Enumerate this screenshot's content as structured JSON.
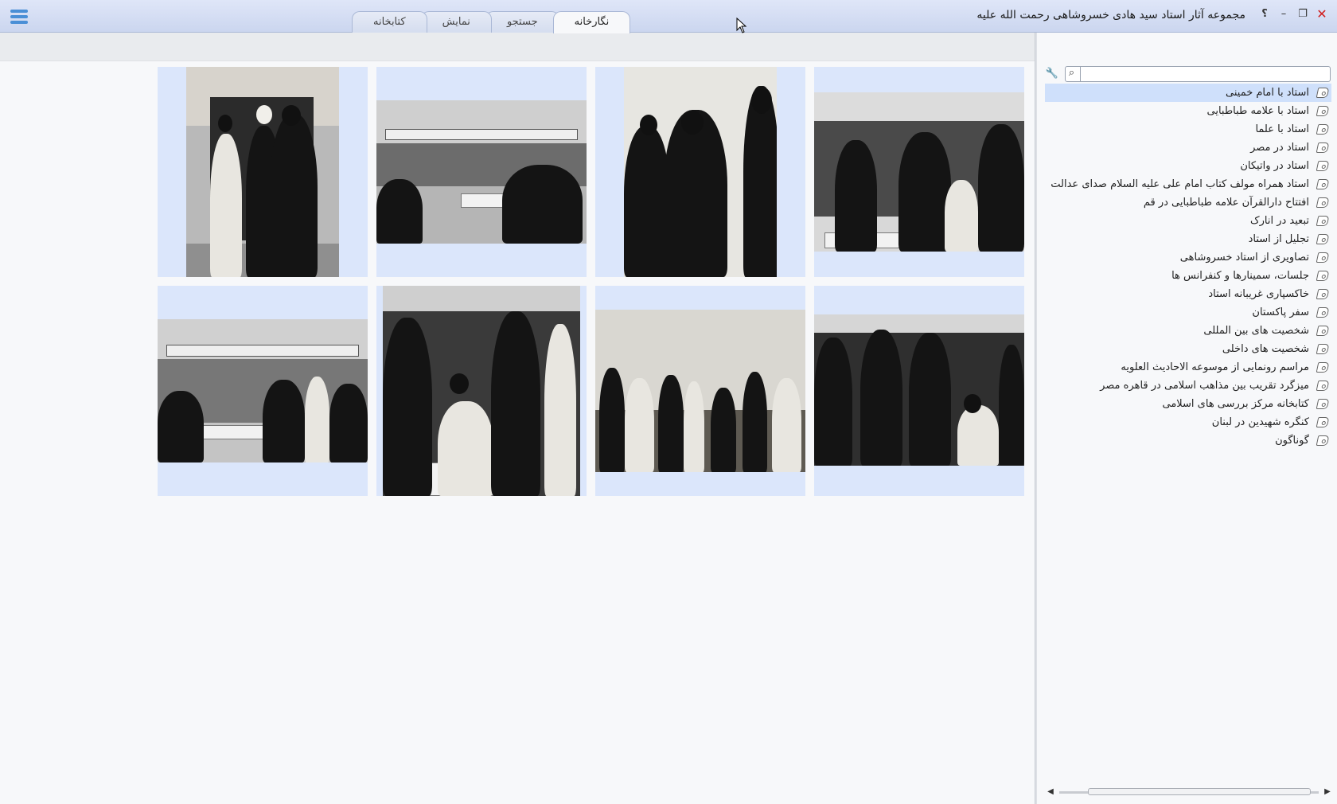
{
  "window": {
    "title": "مجموعه آثار استاد سید هادی خسروشاهی رحمت الله علیه",
    "help": "؟",
    "minimize": "–",
    "maximize": "❐",
    "close": "✕"
  },
  "tabs": [
    {
      "label": "نگارخانه",
      "active": true
    },
    {
      "label": "جستجو",
      "active": false
    },
    {
      "label": "نمایش",
      "active": false
    },
    {
      "label": "کتابخانه",
      "active": false
    }
  ],
  "sidebar": {
    "search": {
      "value": "",
      "placeholder": ""
    },
    "search_icon": "⌕",
    "wrench_icon": "🔧",
    "items": [
      {
        "label": "استاد با امام خمینی",
        "selected": true
      },
      {
        "label": "استاد با علامه طباطبایی"
      },
      {
        "label": "استاد با علما"
      },
      {
        "label": "استاد در مصر"
      },
      {
        "label": "استاد در واتیکان"
      },
      {
        "label": "استاد همراه مولف کتاب امام علی علیه السلام صدای عدالت"
      },
      {
        "label": "افتتاح دارالقرآن علامه طباطبایی در قم"
      },
      {
        "label": "تبعید در انارک"
      },
      {
        "label": "تجلیل از استاد"
      },
      {
        "label": "تصاویری از استاد خسروشاهی"
      },
      {
        "label": "جلسات، سمینارها و کنفرانس ها"
      },
      {
        "label": "خاکسپاری غریبانه استاد"
      },
      {
        "label": "سفر پاکستان"
      },
      {
        "label": "شخصیت های بین المللی"
      },
      {
        "label": "شخصیت های داخلی"
      },
      {
        "label": "مراسم رونمایی از موسوعه  الاحادیث العلویه"
      },
      {
        "label": "میزگرد تقریب بین مذاهب اسلامی در قاهره مصر"
      },
      {
        "label": "کتابخانه مرکز بررسی های اسلامی"
      },
      {
        "label": "کنگره شهیدین در لبنان"
      },
      {
        "label": "گوناگون"
      }
    ]
  },
  "colors": {
    "titlebar": "#cbd6ef",
    "thumb_bg": "#dbe6fb",
    "selected": "#cfe0fb",
    "menu_icon": "#4a8fd6",
    "close": "#d12020"
  }
}
